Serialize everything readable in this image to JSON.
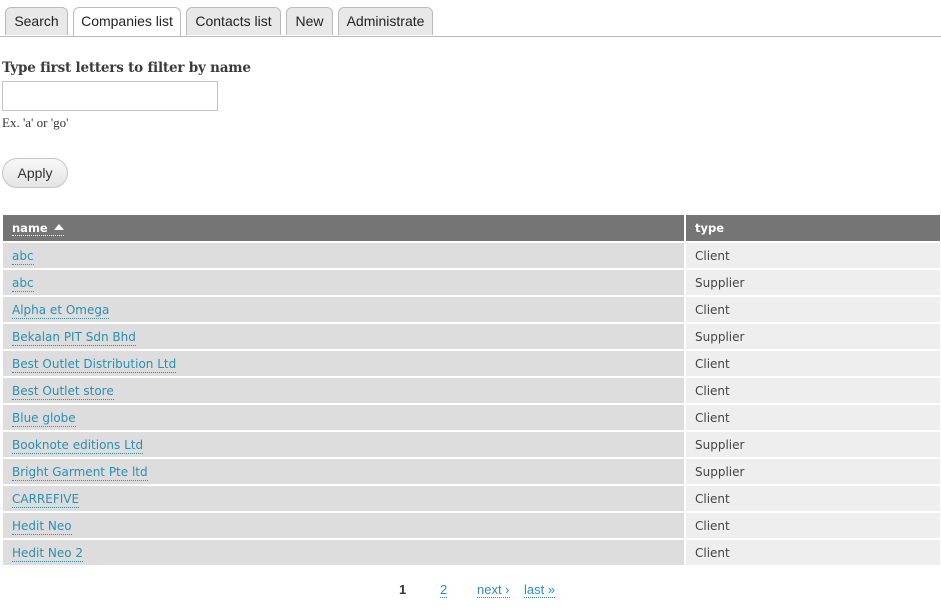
{
  "tabs": [
    {
      "label": "Search",
      "active": false
    },
    {
      "label": "Companies list",
      "active": true
    },
    {
      "label": "Contacts list",
      "active": false
    },
    {
      "label": "New",
      "active": false
    },
    {
      "label": "Administrate",
      "active": false
    }
  ],
  "filter": {
    "label": "Type first letters to filter by name",
    "value": "",
    "placeholder": "",
    "hint": "Ex. 'a' or 'go'",
    "apply_label": "Apply"
  },
  "table": {
    "columns": [
      {
        "label": "name",
        "sorted": "ascending"
      },
      {
        "label": "type"
      }
    ],
    "rows": [
      {
        "name": "abc",
        "type": "Client"
      },
      {
        "name": "abc",
        "type": "Supplier"
      },
      {
        "name": "Alpha et Omega",
        "type": "Client"
      },
      {
        "name": "Bekalan PIT Sdn Bhd",
        "type": "Supplier"
      },
      {
        "name": "Best Outlet Distribution Ltd",
        "type": "Client"
      },
      {
        "name": "Best Outlet store",
        "type": "Client"
      },
      {
        "name": "Blue globe",
        "type": "Client"
      },
      {
        "name": "Booknote editions Ltd",
        "type": "Supplier"
      },
      {
        "name": "Bright Garment Pte ltd",
        "type": "Supplier"
      },
      {
        "name": "CARREFIVE",
        "type": "Client"
      },
      {
        "name": "Hedit Neo",
        "type": "Client"
      },
      {
        "name": "Hedit Neo 2",
        "type": "Client"
      }
    ]
  },
  "pager": {
    "current": "1",
    "page2": "2",
    "next": "next ›",
    "last": "last »"
  },
  "colors": {
    "link": "#2a8fb0",
    "header_bg": "#757575",
    "sorted_col_bg": "#dddddd",
    "col_bg": "#eeeeee"
  }
}
